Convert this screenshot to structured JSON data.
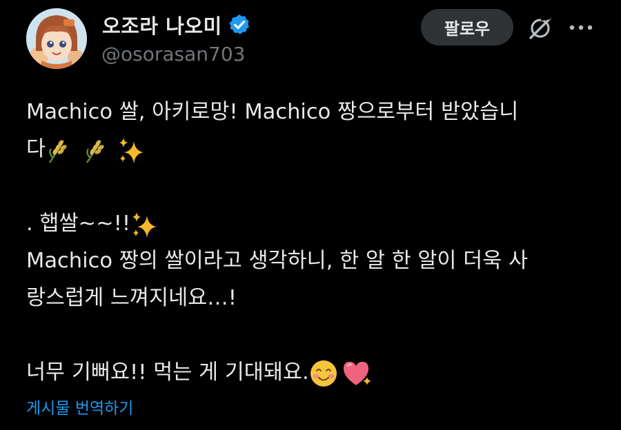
{
  "author": {
    "display_name": "오조라 나오미",
    "handle": "@osorasan703",
    "verified": true
  },
  "actions": {
    "follow_label": "팔로우"
  },
  "tweet": {
    "line1": " Machico 쌀, 아키로망! Machico 짱으로부터 받았습니",
    "line2": "다",
    "line3": ". 햅쌀~~!!",
    "line4": " Machico 짱의 쌀이라고 생각하니, 한 알 한 알이 더욱 사",
    "line5": "랑스럽게 느껴지네요…!",
    "line6": "너무 기뻐요!! 먹는 게 기대돼요.",
    "emoji": [
      "rice-plant",
      "rice-plant",
      "sparkles",
      "sparkles",
      "smiling-face-with-smiling-eyes",
      "sparkling-heart"
    ]
  },
  "translate_label": "게시물 번역하기",
  "colors": {
    "background": "#000000",
    "text": "#e7e9ea",
    "secondary_text": "#71767b",
    "link": "#1d9bf0",
    "verified_badge": "#1d9bf0",
    "follow_button_bg": "#2f3336"
  },
  "icons": [
    "verified-badge-icon",
    "grok-icon",
    "more-icon"
  ]
}
